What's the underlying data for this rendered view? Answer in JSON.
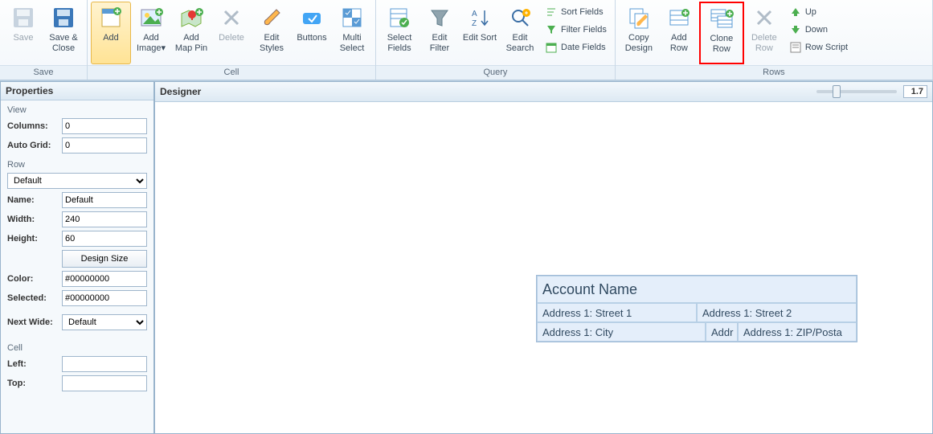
{
  "ribbon": {
    "groups": {
      "save": {
        "label": "Save",
        "save": "Save",
        "save_close": "Save & Close"
      },
      "cell": {
        "label": "Cell",
        "add": "Add",
        "add_image": "Add Image▾",
        "add_map_pin": "Add Map Pin",
        "delete": "Delete",
        "edit_styles": "Edit Styles",
        "buttons": "Buttons",
        "multi_select": "Multi Select"
      },
      "query": {
        "label": "Query",
        "select_fields": "Select Fields",
        "edit_filter": "Edit Filter",
        "edit_sort": "Edit Sort",
        "edit_search": "Edit Search",
        "sort_fields": "Sort Fields",
        "filter_fields": "Filter Fields",
        "date_fields": "Date Fields"
      },
      "rows": {
        "label": "Rows",
        "copy_design": "Copy Design",
        "add_row": "Add Row",
        "clone_row": "Clone Row",
        "delete_row": "Delete Row",
        "up": "Up",
        "down": "Down",
        "row_script": "Row Script"
      }
    }
  },
  "properties": {
    "title": "Properties",
    "view_section": "View",
    "columns_label": "Columns:",
    "columns_value": "0",
    "autogrid_label": "Auto Grid:",
    "autogrid_value": "0",
    "row_section": "Row",
    "row_select_value": "Default",
    "name_label": "Name:",
    "name_value": "Default",
    "width_label": "Width:",
    "width_value": "240",
    "height_label": "Height:",
    "height_value": "60",
    "design_size_btn": "Design Size",
    "color_label": "Color:",
    "color_value": "#00000000",
    "selected_label": "Selected:",
    "selected_value": "#00000000",
    "nextwide_label": "Next Wide:",
    "nextwide_value": "Default",
    "cell_section": "Cell",
    "left_label": "Left:",
    "left_value": "",
    "top_label": "Top:",
    "top_value": ""
  },
  "designer": {
    "title": "Designer",
    "zoom_value": "1.7",
    "card": {
      "title": "Account Name",
      "r1c1": "Address 1: Street 1",
      "r1c2": "Address 1: Street 2",
      "r2c1": "Address 1: City",
      "r2c2": "Addr",
      "r2c3": "Address 1: ZIP/Posta"
    }
  }
}
